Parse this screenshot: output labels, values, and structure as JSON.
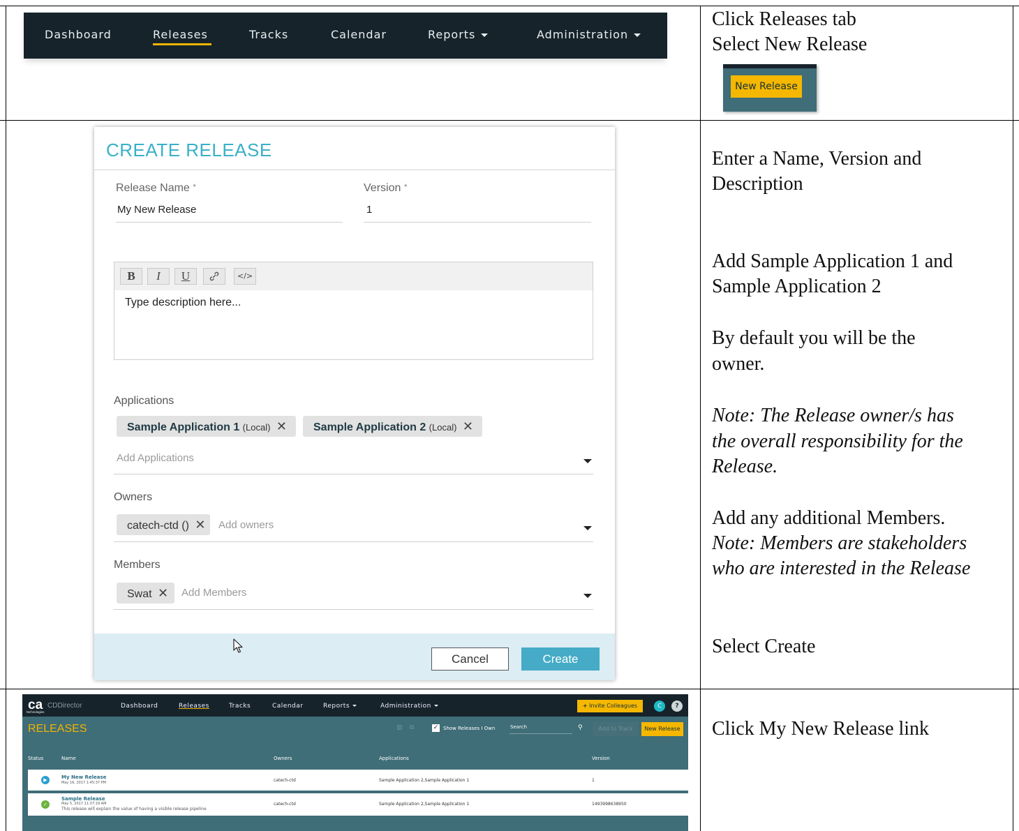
{
  "nav": {
    "items": [
      "Dashboard",
      "Releases",
      "Tracks",
      "Calendar",
      "Reports",
      "Administration"
    ],
    "active": "Releases",
    "active_color": "#f2b400",
    "background": "#16232b"
  },
  "new_release_thumb": {
    "label": "New Release"
  },
  "instructions": {
    "row1": [
      "Click Releases tab",
      "Select New Release"
    ],
    "row2": [
      "Enter a Name, Version and",
      "Description",
      "Add  Sample Application 1 and",
      "Sample Application 2",
      "By default you will be the",
      "owner.",
      "Note: The Release owner/s has",
      "the overall responsibility for the",
      "Release.",
      "Add any additional Members.",
      "Note: Members are stakeholders",
      "who are interested in the Release",
      "Select Create"
    ],
    "row3": [
      "Click My New Release link"
    ]
  },
  "create_release": {
    "title": "CREATE RELEASE",
    "title_color": "#3ab0c8",
    "release_name_label": "Release Name",
    "release_name_value": "My New Release",
    "version_label": "Version",
    "version_value": "1",
    "required_mark": "*",
    "toolbar": [
      "B",
      "I",
      "U",
      "link-icon",
      "code-icon"
    ],
    "description_placeholder": "Type description here...",
    "applications_label": "Applications",
    "applications": [
      {
        "name": "Sample Application 1",
        "scope": "(Local)"
      },
      {
        "name": "Sample Application 2",
        "scope": "(Local)"
      }
    ],
    "add_applications": "Add Applications",
    "owners_label": "Owners",
    "owners": [
      "catech-ctd ()"
    ],
    "add_owners": "Add owners",
    "members_label": "Members",
    "members": [
      "Swat"
    ],
    "add_members": "Add Members",
    "cancel": "Cancel",
    "create": "Create",
    "create_color": "#45abc6",
    "footer_color": "#dcedf4",
    "remove_glyph": "✕"
  },
  "releases_screen": {
    "logo": "ca",
    "logo_sub": "technologies",
    "product": "CDDirector",
    "nav": [
      "Dashboard",
      "Releases",
      "Tracks",
      "Calendar",
      "Reports",
      "Administration"
    ],
    "invite": "Invite Colleagues",
    "invite_icon": "plus-icon",
    "avatar": "C",
    "help": "?",
    "title": "RELEASES",
    "show_own_label": "Show Releases I Own",
    "search_label": "Search",
    "add_to_track": "Add to Track",
    "new_release": "New Release",
    "columns": [
      "Status",
      "Name",
      "Owners",
      "Applications",
      "Version"
    ],
    "rows": [
      {
        "status": "in-progress",
        "status_color": "#2a9fd0",
        "name": "My New Release",
        "date": "May 16, 2017 1:45:37 PM",
        "description": "",
        "owners": "catech-ctd",
        "applications": "Sample Application 2,Sample Application 1",
        "version": "1"
      },
      {
        "status": "complete",
        "status_color": "#6cb33e",
        "name": "Sample Release",
        "date": "May 5, 2017 11:37:19 AM",
        "description": "This release will explain the value of having a visible release pipeline",
        "owners": "catech-ctd",
        "applications": "Sample Application 2,Sample Application 1",
        "version": "1493998638950"
      }
    ]
  }
}
